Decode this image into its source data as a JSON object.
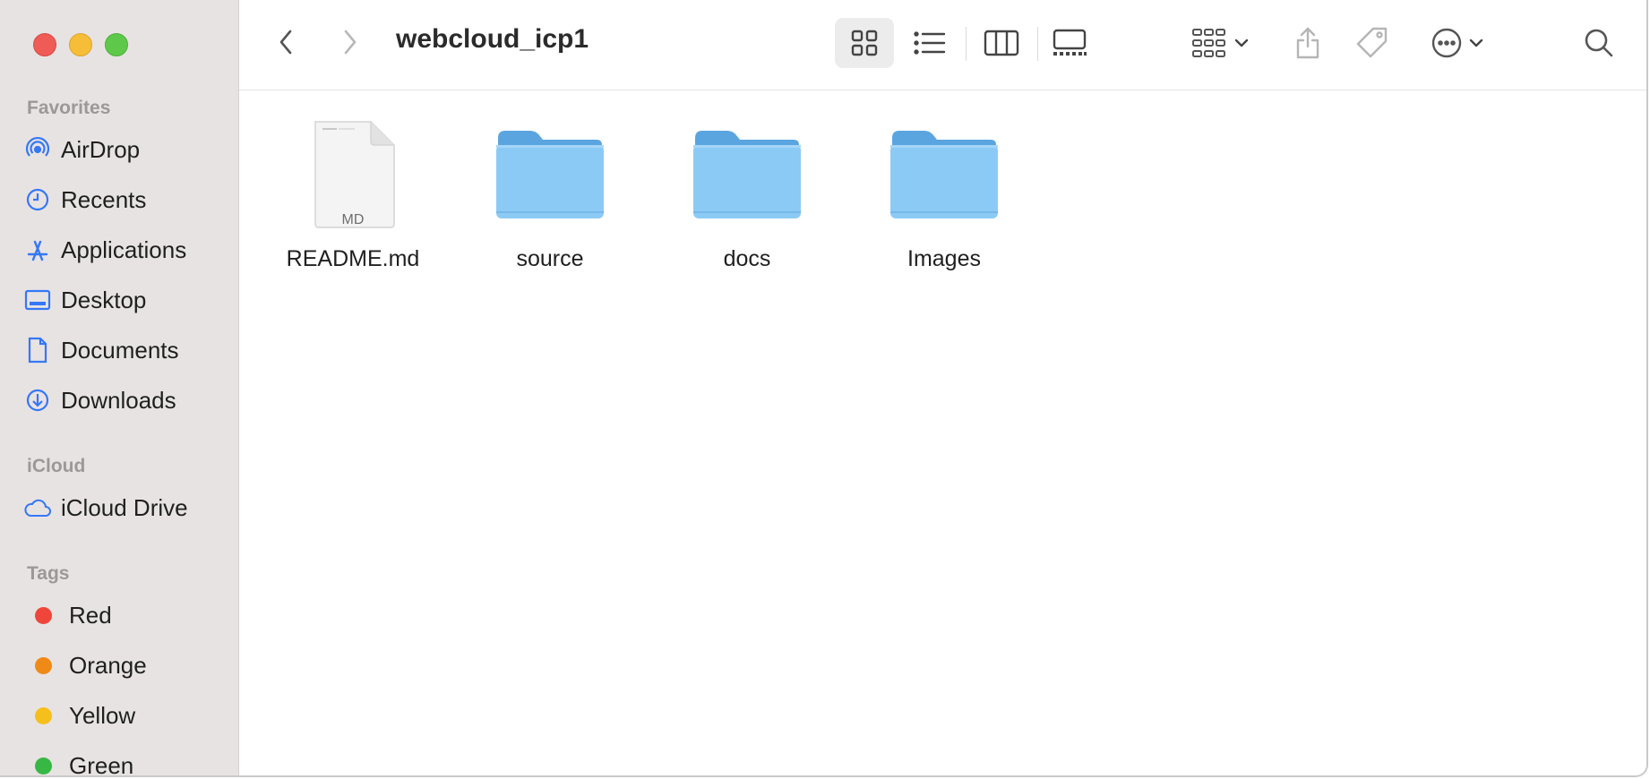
{
  "window": {
    "title": "webcloud_icp1"
  },
  "sidebar": {
    "favorites_heading": "Favorites",
    "favorites": [
      {
        "label": "AirDrop",
        "icon": "airdrop-icon"
      },
      {
        "label": "Recents",
        "icon": "clock-icon"
      },
      {
        "label": "Applications",
        "icon": "applications-icon"
      },
      {
        "label": "Desktop",
        "icon": "desktop-icon"
      },
      {
        "label": "Documents",
        "icon": "document-icon"
      },
      {
        "label": "Downloads",
        "icon": "download-icon"
      }
    ],
    "icloud_heading": "iCloud",
    "icloud": [
      {
        "label": "iCloud Drive",
        "icon": "cloud-icon"
      }
    ],
    "tags_heading": "Tags",
    "tags": [
      {
        "label": "Red",
        "color": "#f0453a"
      },
      {
        "label": "Orange",
        "color": "#f08a16"
      },
      {
        "label": "Yellow",
        "color": "#f5c01c"
      },
      {
        "label": "Green",
        "color": "#37b845"
      }
    ]
  },
  "toolbar": {
    "icons": [
      "back-icon",
      "forward-icon",
      "icon-view-icon",
      "list-view-icon",
      "column-view-icon",
      "gallery-view-icon",
      "group-icon",
      "share-icon",
      "tag-icon",
      "more-icon",
      "search-icon"
    ]
  },
  "files": [
    {
      "name": "README.md",
      "type": "document",
      "badge": "MD"
    },
    {
      "name": "source",
      "type": "folder"
    },
    {
      "name": "docs",
      "type": "folder"
    },
    {
      "name": "Images",
      "type": "folder"
    }
  ],
  "colors": {
    "accent": "#3478f6",
    "folder": "#8ccaf6",
    "sidebar": "#e8e3e3"
  }
}
